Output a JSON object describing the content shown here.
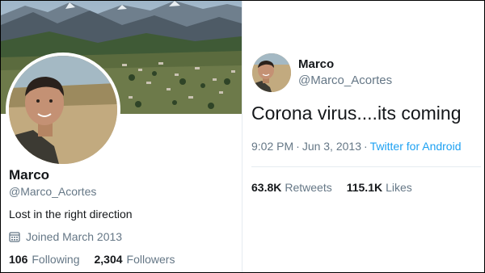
{
  "profile": {
    "display_name": "Marco",
    "handle": "@Marco_Acortes",
    "bio": "Lost in the right direction",
    "joined": "Joined March 2013",
    "following_count": "106",
    "following_label": "Following",
    "followers_count": "2,304",
    "followers_label": "Followers"
  },
  "tweet": {
    "display_name": "Marco",
    "handle": "@Marco_Acortes",
    "text": "Corona virus....its coming",
    "time": "9:02 PM",
    "date": "Jun 3, 2013",
    "separator": "·",
    "source": "Twitter for Android",
    "retweets_count": "63.8K",
    "retweets_label": "Retweets",
    "likes_count": "115.1K",
    "likes_label": "Likes"
  },
  "colors": {
    "link": "#1da1f2",
    "secondary_text": "#657786",
    "primary_text": "#14171a"
  },
  "icons": {
    "calendar": "calendar-icon"
  }
}
